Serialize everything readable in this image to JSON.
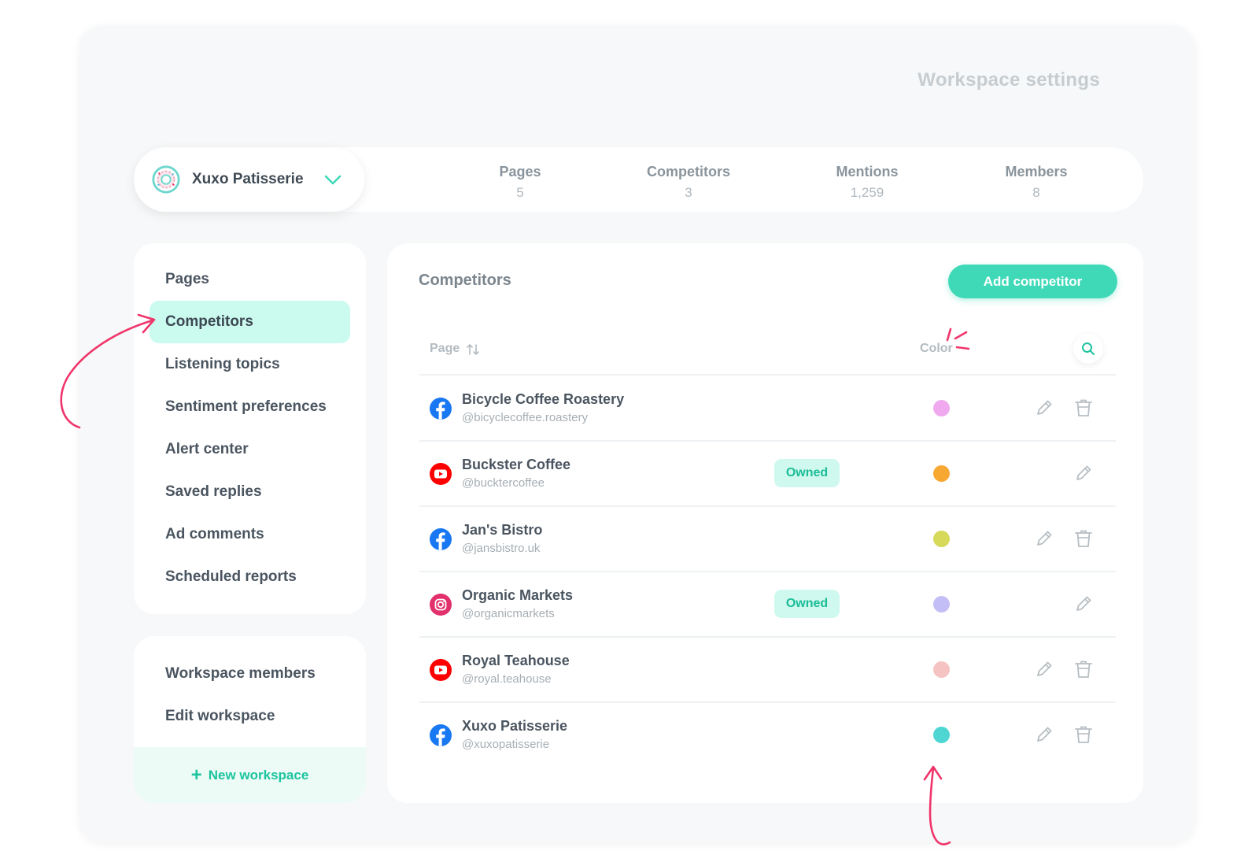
{
  "page_title": "Workspace settings",
  "workspace": {
    "name": "Xuxo Patisserie",
    "logo_icon": "donut-logo",
    "dropdown_icon": "chevron-down-icon"
  },
  "stats": [
    {
      "label": "Pages",
      "value": "5"
    },
    {
      "label": "Competitors",
      "value": "3"
    },
    {
      "label": "Mentions",
      "value": "1,259"
    },
    {
      "label": "Members",
      "value": "8"
    }
  ],
  "nav": {
    "items": [
      {
        "label": "Pages"
      },
      {
        "label": "Competitors",
        "active": true
      },
      {
        "label": "Listening topics"
      },
      {
        "label": "Sentiment preferences"
      },
      {
        "label": "Alert center"
      },
      {
        "label": "Saved replies"
      },
      {
        "label": "Ad comments"
      },
      {
        "label": "Scheduled reports"
      }
    ],
    "secondary": [
      {
        "label": "Workspace members"
      },
      {
        "label": "Edit workspace"
      }
    ],
    "new_workspace": {
      "plus": "+",
      "label": "New workspace"
    }
  },
  "competitors": {
    "title": "Competitors",
    "add_button": "Add competitor",
    "columns": {
      "page": "Page",
      "color": "Color"
    },
    "rows": [
      {
        "platform": "facebook",
        "name": "Bicycle Coffee Roastery",
        "handle": "@bicyclecoffee.roastery",
        "owned": false,
        "color": "#f0a8ee"
      },
      {
        "platform": "youtube",
        "name": "Buckster Coffee",
        "handle": "@bucktercoffee",
        "owned": true,
        "owned_label": "Owned",
        "color": "#f7a832"
      },
      {
        "platform": "facebook",
        "name": "Jan's Bistro",
        "handle": "@jansbistro.uk",
        "owned": false,
        "color": "#d6d95a"
      },
      {
        "platform": "instagram",
        "name": "Organic Markets",
        "handle": "@organicmarkets",
        "owned": true,
        "owned_label": "Owned",
        "color": "#c4bef6"
      },
      {
        "platform": "youtube",
        "name": "Royal Teahouse",
        "handle": "@royal.teahouse",
        "owned": false,
        "color": "#f6c3c3"
      },
      {
        "platform": "facebook",
        "name": "Xuxo Patisserie",
        "handle": "@xuxopatisserie",
        "owned": false,
        "color": "#4fd6d3"
      }
    ]
  },
  "colors": {
    "accent": "#3fd9b8",
    "active_bg": "#cbfaef",
    "annotation": "#f0356b"
  }
}
